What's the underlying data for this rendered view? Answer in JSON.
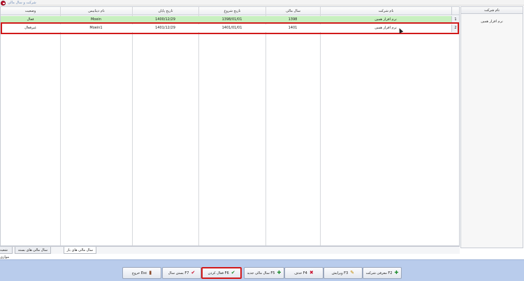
{
  "window": {
    "title": "شرکت و سال مالی"
  },
  "right_panel": {
    "header": "نام شرکت",
    "items": [
      "نرم افزار همین"
    ]
  },
  "grid": {
    "columns": [
      "نام شرکت",
      "سال مالی",
      "تاریخ شروع",
      "تاریخ پایان",
      "نام دیتابیس",
      "وضعیت"
    ],
    "rows": [
      {
        "indicator": "1",
        "cells": [
          "نرم افزار همین",
          "1398",
          "1398/01/01",
          "1400/12/29",
          "Moein",
          "فعال"
        ]
      },
      {
        "indicator": "2",
        "cells": [
          "نرم افزار همین",
          "1401",
          "1401/01/01",
          "1401/12/29",
          "Moein1",
          "غیرفعال"
        ]
      }
    ]
  },
  "tabs": [
    {
      "label": "سال مالی های باز",
      "active": true
    },
    {
      "label": "سال مالی های بسته",
      "active": false
    },
    {
      "label": "شعبه موازی",
      "active": false
    }
  ],
  "toolbar": {
    "buttons": [
      {
        "label": "معرفی شرکت F2",
        "icon": "plus-icon",
        "color": "#1a8a2a"
      },
      {
        "label": "ویرایش F3",
        "icon": "pencil-icon",
        "color": "#c08a00"
      },
      {
        "label": "حذف F4",
        "icon": "delete-icon",
        "color": "#c8102e"
      },
      {
        "label": "سال مالی جدید F5",
        "icon": "plus-icon",
        "color": "#1a8a2a"
      },
      {
        "label": "فعال کردن F6",
        "icon": "check-icon",
        "color": "#1a8a2a"
      },
      {
        "label": "بستن سال F7",
        "icon": "check-icon",
        "color": "#c8102e"
      },
      {
        "label": "خروج Esc",
        "icon": "exit-icon",
        "color": "#8a4a2a"
      }
    ]
  },
  "colors": {
    "active_row": "#c8f0c0",
    "highlight": "#d11a1a",
    "toolbar_bg": "#b9ccec"
  }
}
